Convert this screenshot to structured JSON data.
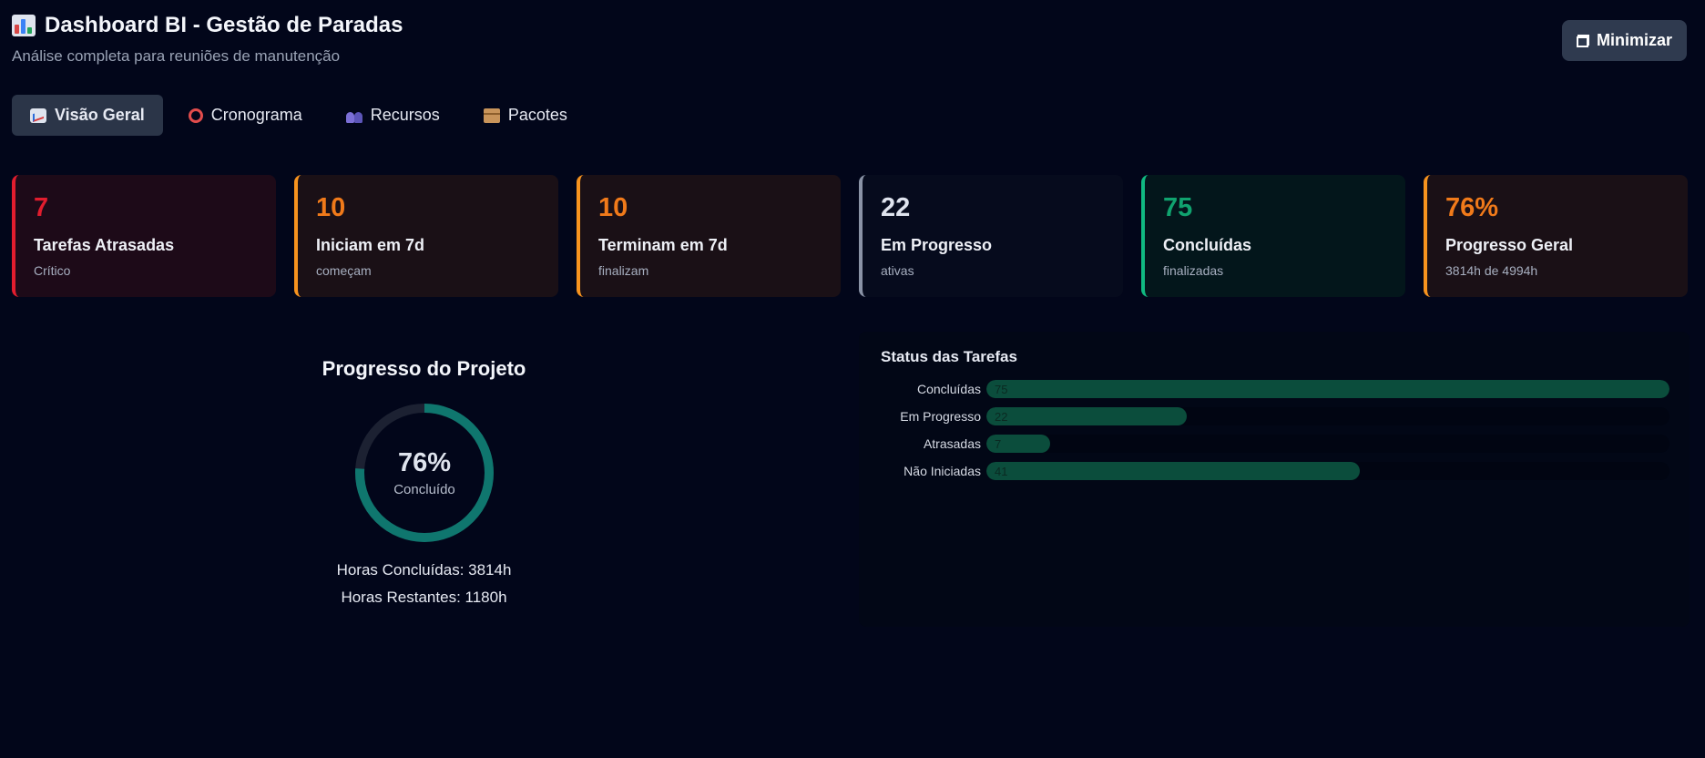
{
  "header": {
    "title": "Dashboard BI - Gestão de Paradas",
    "subtitle": "Análise completa para reuniões de manutenção",
    "logo_icon": "bar-chart-icon"
  },
  "toolbar": {
    "minimize_label": "Minimizar",
    "minimize_icon": "restore-window-icon"
  },
  "tabs": [
    {
      "label": "Visão Geral",
      "icon": "chart-increasing-icon",
      "active": true
    },
    {
      "label": "Cronograma",
      "icon": "alarm-clock-icon",
      "active": false
    },
    {
      "label": "Recursos",
      "icon": "people-icon",
      "active": false
    },
    {
      "label": "Pacotes",
      "icon": "package-icon",
      "active": false
    }
  ],
  "cards": [
    {
      "value": "7",
      "label": "Tarefas Atrasadas",
      "sub": "Crítico",
      "accent": "#e11d2e",
      "bg": "#1d0a18"
    },
    {
      "value": "10",
      "label": "Iniciam em 7d",
      "sub": "começam",
      "accent": "#f7931e",
      "bg": "#1a1016"
    },
    {
      "value": "10",
      "label": "Terminam em 7d",
      "sub": "finalizam",
      "accent": "#f7931e",
      "bg": "#1a1016"
    },
    {
      "value": "22",
      "label": "Em Progresso",
      "sub": "ativas",
      "accent": "#8a93a6",
      "bg": "#060b1d"
    },
    {
      "value": "75",
      "label": "Concluídas",
      "sub": "finalizadas",
      "accent": "#10b981",
      "bg": "#03161b"
    },
    {
      "value": "76%",
      "label": "Progresso Geral",
      "sub": "3814h de 4994h",
      "accent": "#f7931e",
      "bg": "#1a1016"
    }
  ],
  "card_value_colors": [
    "#e11d2e",
    "#f07a1a",
    "#f07a1a",
    "#dfe4ee",
    "#10a36f",
    "#f07a1a"
  ],
  "progress": {
    "title": "Progresso do Projeto",
    "percent_label": "76%",
    "percent": 76,
    "caption": "Concluído",
    "hours_done": "Horas Concluídas: 3814h",
    "hours_left": "Horas Restantes: 1180h",
    "ring_color": "#0f766e",
    "track_color": "#1c2132"
  },
  "status": {
    "title": "Status das Tarefas",
    "max": 75,
    "bars": [
      {
        "label": "Concluídas",
        "value": 75
      },
      {
        "label": "Em Progresso",
        "value": 22
      },
      {
        "label": "Atrasadas",
        "value": 7
      },
      {
        "label": "Não Iniciadas",
        "value": 41
      }
    ]
  }
}
